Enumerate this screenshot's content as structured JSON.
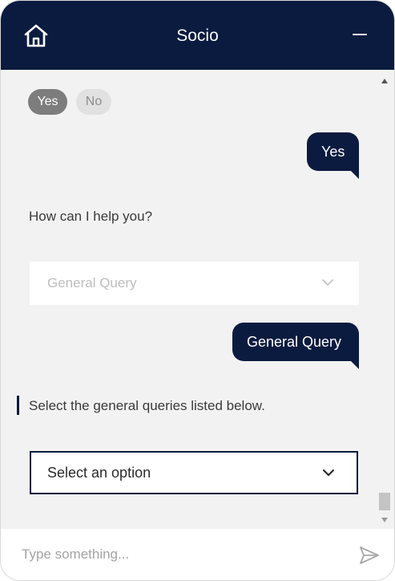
{
  "header": {
    "title": "Socio",
    "home_icon": "home-icon",
    "minimize_icon": "minimize-icon",
    "background": "#0b1b3f"
  },
  "chat": {
    "quick_replies": [
      {
        "label": "Yes",
        "selected": true
      },
      {
        "label": "No",
        "selected": false
      }
    ],
    "messages": [
      {
        "from": "user",
        "text": "Yes"
      },
      {
        "from": "bot",
        "text": "How can I help you?"
      },
      {
        "from": "bot-dropdown",
        "value": "General Query",
        "disabled": true
      },
      {
        "from": "user",
        "text": "General Query"
      },
      {
        "from": "bot",
        "text": "Select the general queries listed below."
      }
    ],
    "active_dropdown": {
      "value": "Select an option",
      "icon": "chevron-down-icon"
    }
  },
  "composer": {
    "placeholder": "Type something...",
    "send_icon": "send-icon"
  },
  "colors": {
    "accent": "#0b1b3f",
    "chat_background": "#f2f2f2",
    "chip_selected": "#7d7d7d",
    "chip_unselected": "#e1e1e1"
  }
}
